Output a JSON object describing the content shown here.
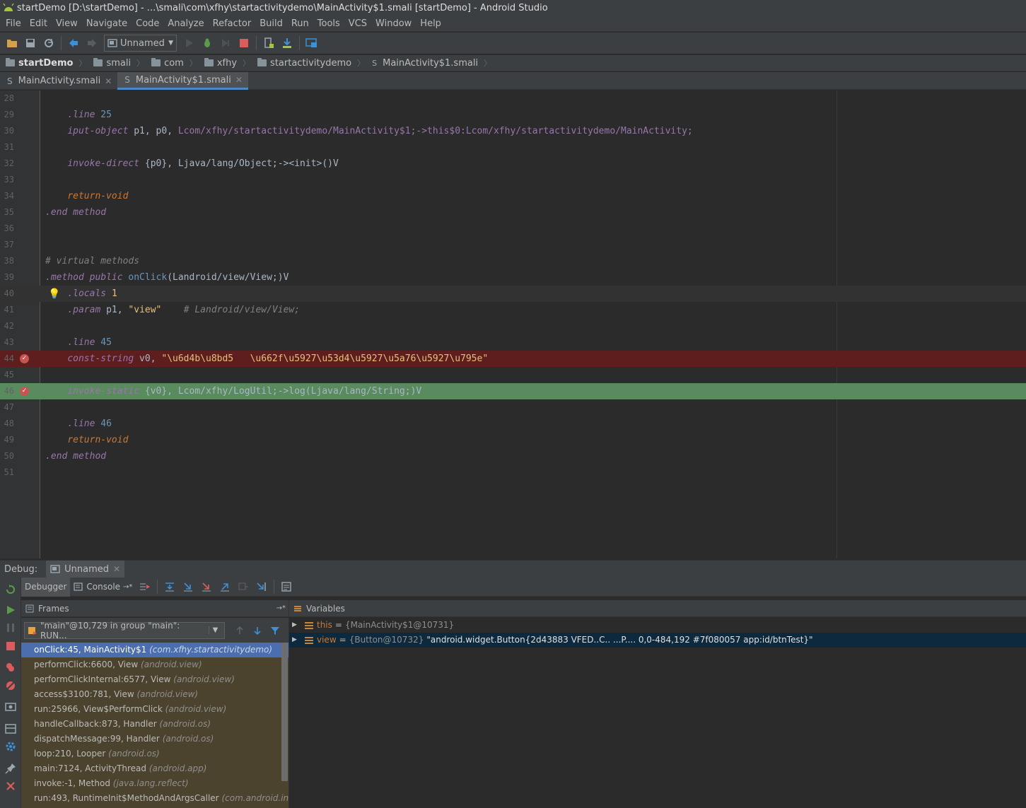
{
  "window": {
    "title": "startDemo [D:\\startDemo] - ...\\smali\\com\\xfhy\\startactivitydemo\\MainActivity$1.smali [startDemo] - Android Studio"
  },
  "menu": [
    "File",
    "Edit",
    "View",
    "Navigate",
    "Code",
    "Analyze",
    "Refactor",
    "Build",
    "Run",
    "Tools",
    "VCS",
    "Window",
    "Help"
  ],
  "toolbar": {
    "run_config": "Unnamed"
  },
  "breadcrumb": [
    "startDemo",
    "smali",
    "com",
    "xfhy",
    "startactivitydemo",
    "MainActivity$1.smali"
  ],
  "tabs": [
    {
      "label": "MainActivity.smali",
      "active": false
    },
    {
      "label": "MainActivity$1.smali",
      "active": true
    }
  ],
  "editor": {
    "lines": [
      {
        "n": "28",
        "html": ""
      },
      {
        "n": "29",
        "html": "    <span class='dir'>.line</span> <span class='num'>25</span>"
      },
      {
        "n": "30",
        "html": "    <span class='dir'>iput-object</span> p1, p0, <span class='typ'>Lcom/xfhy/startactivitydemo/MainActivity$1;-&gt;this$0:Lcom/xfhy/startactivitydemo/MainActivity;</span>"
      },
      {
        "n": "31",
        "html": ""
      },
      {
        "n": "32",
        "html": "    <span class='dir'>invoke-direct</span> {p0}, Ljava/lang/Object;-&gt;&lt;init&gt;()V"
      },
      {
        "n": "33",
        "html": ""
      },
      {
        "n": "34",
        "html": "    <span class='kw'>return-void</span>"
      },
      {
        "n": "35",
        "html": "<span class='dir'>.end method</span>"
      },
      {
        "n": "36",
        "html": ""
      },
      {
        "n": "37",
        "html": ""
      },
      {
        "n": "38",
        "html": "<span class='cmt2'># virtual methods</span>"
      },
      {
        "n": "39",
        "html": "<span class='dir'>.method public</span> <span class='num'>onClick</span>(Landroid/view/View;)V"
      },
      {
        "n": "40",
        "html": "    <span class='dir'>.locals</span> <span class='str'>1</span>",
        "state": "current",
        "bulb": true
      },
      {
        "n": "41",
        "html": "    <span class='dir'>.param</span> p1, <span class='str'>\"view\"</span>    <span class='cmt2'># Landroid/view/View;</span>"
      },
      {
        "n": "42",
        "html": ""
      },
      {
        "n": "43",
        "html": "    <span class='dir'>.line</span> <span class='num'>45</span>"
      },
      {
        "n": "44",
        "html": "    <span class='dir'>const-string</span> v0, <span class='str'>\"\\u6d4b\\u8bd5   \\u662f\\u5927\\u53d4\\u5927\\u5a76\\u5927\\u795e\"</span>",
        "state": "bp-hit",
        "bp": true
      },
      {
        "n": "45",
        "html": ""
      },
      {
        "n": "46",
        "html": "    <span class='dir'>invoke-static</span> {v0}, Lcom/xfhy/LogUtil;-&gt;log(Ljava/lang/String;)V",
        "state": "exec",
        "bp": true
      },
      {
        "n": "47",
        "html": ""
      },
      {
        "n": "48",
        "html": "    <span class='dir'>.line</span> <span class='num'>46</span>"
      },
      {
        "n": "49",
        "html": "    <span class='kw'>return-void</span>"
      },
      {
        "n": "50",
        "html": "<span class='dir'>.end method</span>"
      },
      {
        "n": "51",
        "html": ""
      }
    ]
  },
  "debug": {
    "label": "Debug:",
    "session_tab": "Unnamed",
    "sub_tabs": [
      "Debugger",
      "Console"
    ],
    "frames_title": "Frames",
    "variables_title": "Variables",
    "thread": "\"main\"@10,729 in group \"main\": RUN...",
    "frames": [
      {
        "loc": "onClick:45, MainActivity$1",
        "pkg": "(com.xfhy.startactivitydemo)",
        "selected": true
      },
      {
        "loc": "performClick:6600, View",
        "pkg": "(android.view)"
      },
      {
        "loc": "performClickInternal:6577, View",
        "pkg": "(android.view)"
      },
      {
        "loc": "access$3100:781, View",
        "pkg": "(android.view)"
      },
      {
        "loc": "run:25966, View$PerformClick",
        "pkg": "(android.view)"
      },
      {
        "loc": "handleCallback:873, Handler",
        "pkg": "(android.os)"
      },
      {
        "loc": "dispatchMessage:99, Handler",
        "pkg": "(android.os)"
      },
      {
        "loc": "loop:210, Looper",
        "pkg": "(android.os)"
      },
      {
        "loc": "main:7124, ActivityThread",
        "pkg": "(android.app)"
      },
      {
        "loc": "invoke:-1, Method",
        "pkg": "(java.lang.reflect)"
      },
      {
        "loc": "run:493, RuntimeInit$MethodAndArgsCaller",
        "pkg": "(com.android.inte"
      }
    ],
    "variables": [
      {
        "name": "this",
        "value": "{MainActivity$1@10731}",
        "str": ""
      },
      {
        "name": "view",
        "value": "{Button@10732}",
        "str": "\"android.widget.Button{2d43883 VFED..C.. ...P.... 0,0-484,192 #7f080057 app:id/btnTest}\"",
        "selected": true
      }
    ]
  },
  "colors": {
    "breakpoint": "#c75450",
    "exec_line": "#5a8b5e",
    "bp_line": "#5e1e1e",
    "accent": "#4a88c7"
  }
}
